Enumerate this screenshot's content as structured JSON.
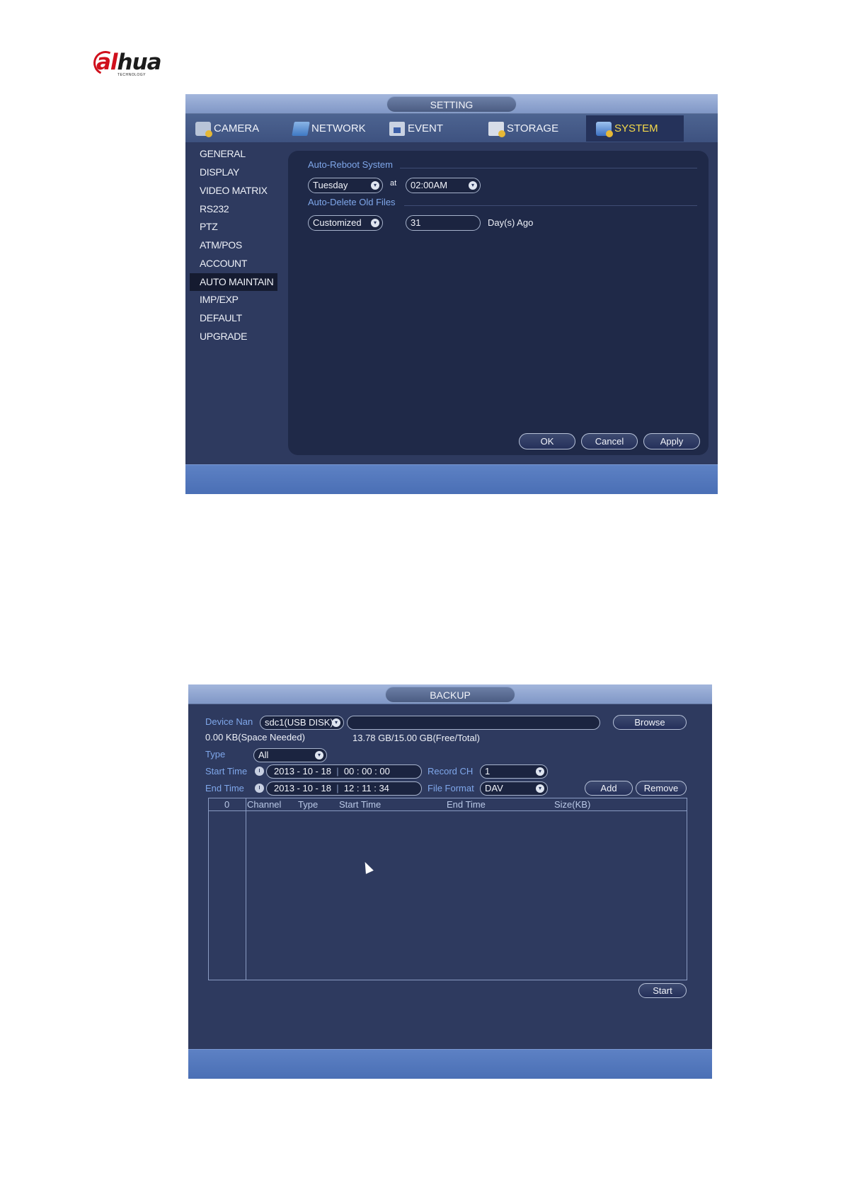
{
  "logo": {
    "brand_main": "hua",
    "brand_a": "al",
    "sub": "TECHNOLOGY"
  },
  "setting": {
    "title": "SETTING",
    "tabs": [
      {
        "label": "CAMERA",
        "icon": "camera-icon",
        "active": false
      },
      {
        "label": "NETWORK",
        "icon": "network-icon",
        "active": false
      },
      {
        "label": "EVENT",
        "icon": "event-icon",
        "active": false
      },
      {
        "label": "STORAGE",
        "icon": "storage-icon",
        "active": false
      },
      {
        "label": "SYSTEM",
        "icon": "system-icon",
        "active": true
      }
    ],
    "sidebar": [
      {
        "label": "GENERAL"
      },
      {
        "label": "DISPLAY"
      },
      {
        "label": "VIDEO MATRIX"
      },
      {
        "label": "RS232"
      },
      {
        "label": "PTZ"
      },
      {
        "label": "ATM/POS"
      },
      {
        "label": "ACCOUNT"
      },
      {
        "label": "AUTO MAINTAIN",
        "active": true
      },
      {
        "label": "IMP/EXP"
      },
      {
        "label": "DEFAULT"
      },
      {
        "label": "UPGRADE"
      }
    ],
    "auto_reboot": {
      "label": "Auto-Reboot System",
      "day": "Tuesday",
      "at": "at",
      "time": "02:00AM"
    },
    "auto_delete": {
      "label": "Auto-Delete Old Files",
      "mode": "Customized",
      "days": "31",
      "suffix": "Day(s) Ago"
    },
    "buttons": {
      "ok": "OK",
      "cancel": "Cancel",
      "apply": "Apply"
    }
  },
  "backup": {
    "title": "BACKUP",
    "device_label": "Device Nan",
    "device_value": "sdc1(USB DISK)",
    "path_value": "",
    "browse": "Browse",
    "space_needed": "0.00 KB(Space Needed)",
    "free_total": "13.78 GB/15.00 GB(Free/Total)",
    "type_label": "Type",
    "type_value": "All",
    "start_label": "Start Time",
    "start_date": "2013 - 10 - 18",
    "start_time": "00 : 00 : 00",
    "end_label": "End Time",
    "end_date": "2013 - 10 - 18",
    "end_time": "12 : 11 : 34",
    "record_ch_label": "Record CH",
    "record_ch_value": "1",
    "file_format_label": "File Format",
    "file_format_value": "DAV",
    "add": "Add",
    "remove": "Remove",
    "table_headers": [
      "0",
      "Channel",
      "Type",
      "Start Time",
      "End Time",
      "Size(KB)"
    ],
    "start": "Start"
  },
  "colors": {
    "panel_bg": "#2e3a5f",
    "content_bg": "#1f2948",
    "label_blue": "#7fa7ea",
    "active_tab_text": "#f5d94a",
    "logo_red": "#d0101c"
  }
}
